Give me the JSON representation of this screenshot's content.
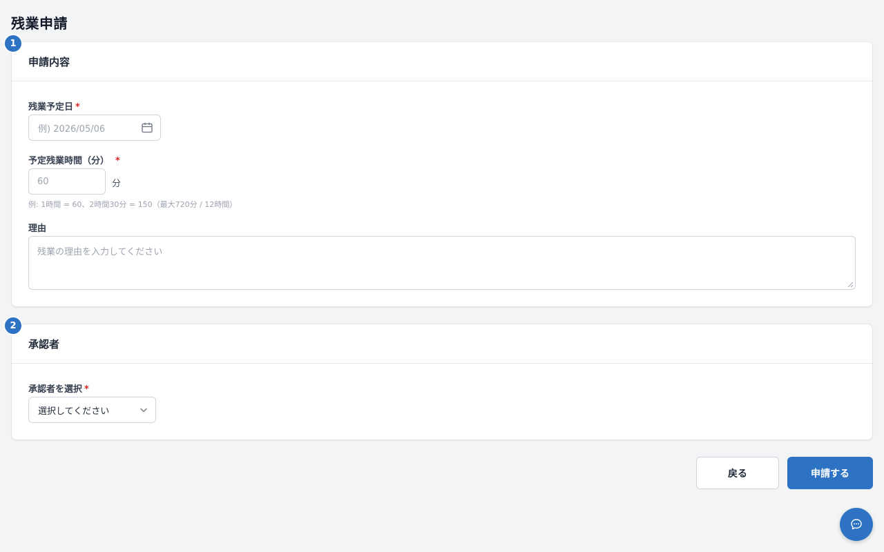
{
  "page": {
    "title": "残業申請"
  },
  "theme": {
    "accent": "#2e72c4",
    "required": "#dc2626"
  },
  "section1": {
    "step": "1",
    "title": "申請内容",
    "date": {
      "label": "残業予定日",
      "required_mark": "*",
      "placeholder": "例) 2026/05/06",
      "icon": "calendar-icon"
    },
    "minutes": {
      "label": "予定残業時間（分）",
      "required_mark": "*",
      "placeholder": "60",
      "unit": "分",
      "hint": "例: 1時間 = 60、2時間30分 = 150（最大720分 / 12時間）"
    },
    "reason": {
      "label": "理由",
      "placeholder": "残業の理由を入力してください"
    }
  },
  "section2": {
    "step": "2",
    "title": "承認者",
    "approver": {
      "label": "承認者を選択",
      "required_mark": "*",
      "selected": "選択してください",
      "icon": "chevron-down-icon"
    }
  },
  "actions": {
    "back_label": "戻る",
    "submit_label": "申請する"
  },
  "chat": {
    "icon": "chat-bubble-icon"
  }
}
